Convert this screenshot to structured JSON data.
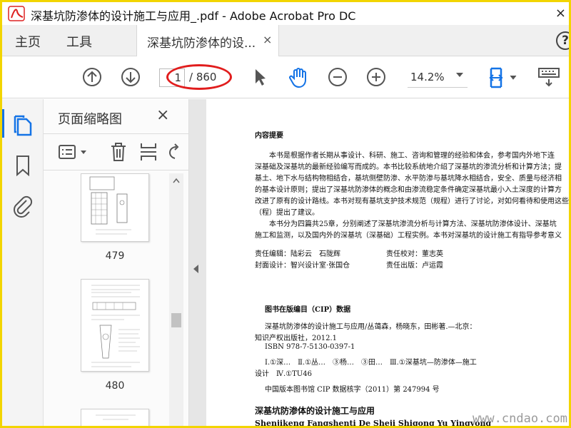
{
  "window": {
    "title": "深基坑防渗体的设计施工与应用_.pdf - Adobe Acrobat Pro DC",
    "close_glyph": "×"
  },
  "nav": {
    "home_label": "主页",
    "tools_label": "工具",
    "doc_tab_label": "深基坑防渗体的设...",
    "doc_tab_close": "×",
    "help_label": "?"
  },
  "toolbar": {
    "current_page": "1",
    "total_pages": "/ 860",
    "zoom": "14.2%",
    "highlight_color": "#e11d1d"
  },
  "sidebar": {
    "panel_title": "页面缩略图",
    "close_glyph": "×"
  },
  "thumbnails": [
    {
      "page": "479"
    },
    {
      "page": "480"
    }
  ],
  "document": {
    "summary_heading": "内容提要",
    "summary_lines": [
      "本书是根据作者长期从事设计、科研、施工、咨询和管理的经验和体会，参考国内外地下连",
      "深基础及深基坑的最新经验编写而成的。本书比较系统地介绍了深基坑的渗流分析和计算方法；提",
      "基土、地下水与结构物相结合，基坑侧壁防渗、水平防渗与基坑降水相结合，安全、质量与经济相",
      "的基本设计原则；提出了深基坑防渗体的概念和由渗流稳定条件确定深基坑最小入土深度的计算方",
      "改进了原有的设计路线。本书对现有基坑支护技术规范（规程）进行了讨论，对如何看待和使用这些",
      "（程）提出了建议。",
      "本书分为四篇共25章，分别阐述了深基坑渗流分析与计算方法、深基坑防渗体设计、深基坑",
      "施工和监测，以及国内外的深基坑（深基础）工程实例。本书对深基坑的设计施工有指导参考意义"
    ],
    "editor_label": "责任编辑：陆彩云　石陇辉",
    "proofreader_label": "责任校对：董志英",
    "cover_label": "封面设计：智兴设计室·张国仓",
    "publisher_label": "责任出版：卢运霞",
    "cip_heading": "图书在版编目（CIP）数据",
    "cip_lines": [
      "深基坑防渗体的设计施工与应用/丛蔼森，杨晓东，田彬著.—北京：",
      "知识产权出版社，2012.1",
      "ISBN 978-7-5130-0397-1",
      "Ⅰ.①深…　Ⅱ.①丛…　③杨…　③田…　Ⅲ.①深基坑—防渗体—施工",
      "设计　Ⅳ.①TU46",
      "中国版本图书馆 CIP 数据核字（2011）第 247994 号"
    ],
    "book_title_cn": "深基坑防渗体的设计施工与应用",
    "book_title_py": "Shenjikeng Fangshenti De Sheji Shigong Yu Yingyong"
  },
  "watermark": "www.cndao.com",
  "icons": [
    "prev-page-icon",
    "next-page-icon",
    "select-cursor-icon",
    "hand-tool-icon",
    "zoom-out-icon",
    "zoom-in-icon",
    "page-fit-icon",
    "keyboard-scroll-icon",
    "thumbnails-icon",
    "bookmark-icon",
    "attachment-icon",
    "options-icon",
    "delete-icon",
    "insert-icon",
    "rotate-icon"
  ]
}
